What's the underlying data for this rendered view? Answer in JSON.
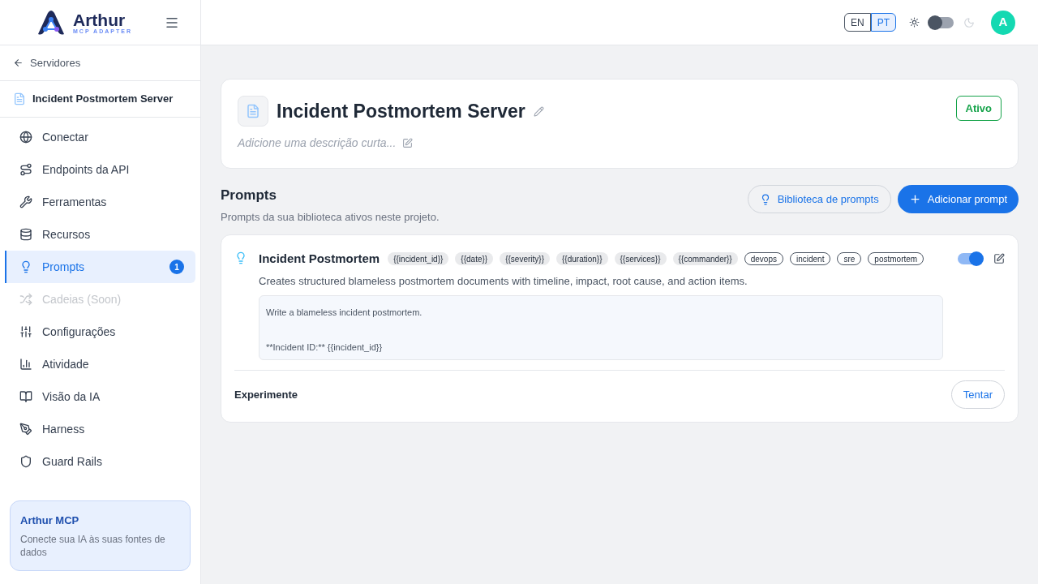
{
  "logo": {
    "name": "Arthur",
    "tagline": "MCP ADAPTER"
  },
  "sidebar": {
    "back": "Servidores",
    "server": "Incident Postmortem Server",
    "items": [
      {
        "label": "Conectar",
        "selected": false,
        "disabled": false
      },
      {
        "label": "Endpoints da API",
        "selected": false,
        "disabled": false
      },
      {
        "label": "Ferramentas",
        "selected": false,
        "disabled": false
      },
      {
        "label": "Recursos",
        "selected": false,
        "disabled": false
      },
      {
        "label": "Prompts",
        "selected": true,
        "disabled": false,
        "badge": "1"
      },
      {
        "label": "Cadeias (Soon)",
        "selected": false,
        "disabled": true
      },
      {
        "label": "Configurações",
        "selected": false,
        "disabled": false
      },
      {
        "label": "Atividade",
        "selected": false,
        "disabled": false
      },
      {
        "label": "Visão da IA",
        "selected": false,
        "disabled": false
      },
      {
        "label": "Harness",
        "selected": false,
        "disabled": false
      },
      {
        "label": "Guard Rails",
        "selected": false,
        "disabled": false
      }
    ],
    "promo": {
      "title": "Arthur MCP",
      "text": "Conecte sua IA às suas fontes de dados"
    }
  },
  "header": {
    "languages": [
      {
        "label": "EN",
        "selected": false
      },
      {
        "label": "PT",
        "selected": true
      }
    ],
    "dark_mode": false,
    "avatar": "A"
  },
  "server": {
    "title": "Incident Postmortem Server",
    "description_placeholder": "Adicione uma descrição curta...",
    "status": "Ativo"
  },
  "section": {
    "title": "Prompts",
    "subtitle": "Prompts da sua biblioteca ativos neste projeto.",
    "library_button": "Biblioteca de prompts",
    "add_button": "Adicionar prompt"
  },
  "prompt": {
    "name": "Incident Postmortem",
    "enabled": true,
    "tags": [
      {
        "kind": "variable",
        "label": "{{incident_id}}"
      },
      {
        "kind": "variable",
        "label": "{{date}}"
      },
      {
        "kind": "variable",
        "label": "{{severity}}"
      },
      {
        "kind": "variable",
        "label": "{{duration}}"
      },
      {
        "kind": "variable",
        "label": "{{services}}"
      },
      {
        "kind": "variable",
        "label": "{{commander}}"
      },
      {
        "kind": "tag",
        "label": "devops"
      },
      {
        "kind": "tag",
        "label": "incident"
      },
      {
        "kind": "tag",
        "label": "sre"
      },
      {
        "kind": "tag",
        "label": "postmortem"
      }
    ],
    "description": "Creates structured blameless postmortem documents with timeline, impact, root cause, and action items.",
    "template_lines": [
      "Write a blameless incident postmortem.",
      "**Incident ID:** {{incident_id}}"
    ],
    "try_label": "Experimente",
    "try_button": "Tentar"
  }
}
